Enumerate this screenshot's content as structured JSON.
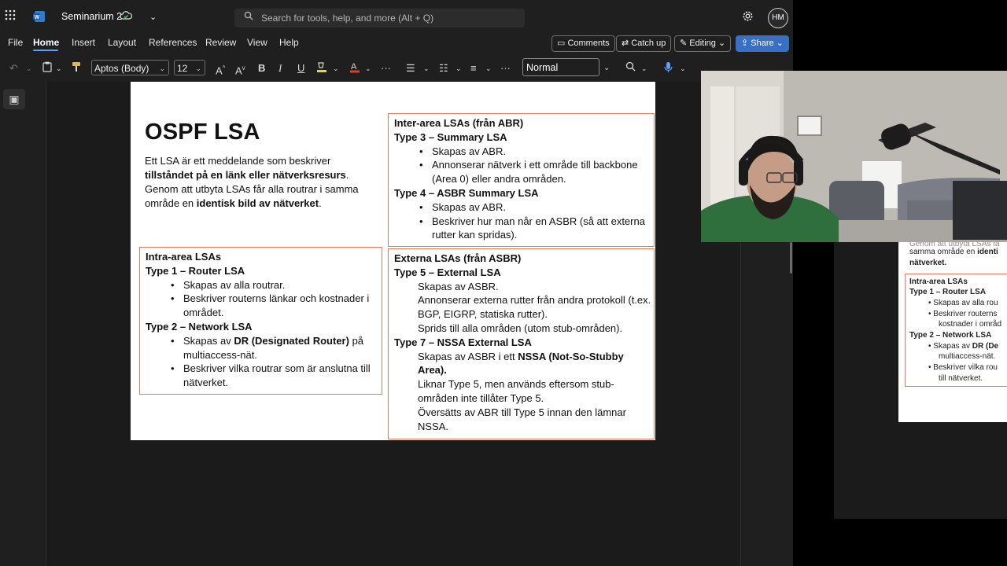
{
  "app": {
    "doc_title": "Seminarium 2",
    "search_placeholder": "Search for tools, help, and more (Alt + Q)",
    "avatar_initials": "HM",
    "icons": [
      "app-launcher-icon",
      "word-logo-icon",
      "cloud-sync-icon",
      "chevron-down-icon",
      "search-icon",
      "settings-icon"
    ]
  },
  "menu": {
    "items": [
      "File",
      "Home",
      "Insert",
      "Layout",
      "References",
      "Review",
      "View",
      "Help"
    ],
    "active": "Home",
    "comments": "Comments",
    "catchup": "Catch up",
    "editing": "Editing",
    "share": "Share"
  },
  "toolbar": {
    "font_name": "Aptos (Body)",
    "font_size": "12",
    "style": "Normal",
    "bold": "B",
    "italic": "I",
    "underline": "U"
  },
  "document": {
    "title": "OSPF LSA",
    "intro_1a": "Ett LSA är ett meddelande som beskriver ",
    "intro_1b": "tillståndet på en länk eller nätverksresurs",
    "intro_1c": ".",
    "intro_2a": "Genom att utbyta LSAs får alla routrar i samma område en ",
    "intro_2b": "identisk bild av nätverket",
    "intro_2c": ".",
    "intra": {
      "heading": "Intra-area LSAs",
      "t1": "Type 1 – Router LSA",
      "t1_b1": "Skapas av alla routrar.",
      "t1_b2": "Beskriver routerns länkar och kostnader i området.",
      "t2": "Type 2 – Network LSA",
      "t2_b1a": "Skapas av ",
      "t2_b1b": "DR (Designated Router)",
      "t2_b1c": " på multiaccess-nät.",
      "t2_b2": "Beskriver vilka routrar som är anslutna till nätverket."
    },
    "inter": {
      "heading": "Inter-area LSAs (från ABR)",
      "t3": "Type 3 – Summary LSA",
      "t3_b1": "Skapas av ABR.",
      "t3_b2": "Annonserar nätverk i ett område till backbone (Area 0) eller andra områden.",
      "t4": "Type 4 – ASBR Summary LSA",
      "t4_b1": "Skapas av ABR.",
      "t4_b2": "Beskriver hur man når en ASBR (så att externa rutter kan spridas)."
    },
    "ext": {
      "heading": "Externa LSAs (från ASBR)",
      "t5": "Type 5 – External LSA",
      "t5_l1": "Skapas av ASBR.",
      "t5_l2": "Annonserar externa rutter från andra protokoll (t.ex. BGP, EIGRP, statiska rutter).",
      "t5_l3": "Sprids till alla områden (utom stub-områden).",
      "t7": "Type 7 – NSSA External LSA",
      "t7_l1a": "Skapas av ASBR i ett ",
      "t7_l1b": "NSSA (Not-So-Stubby Area).",
      "t7_l2": "Liknar Type 5, men används eftersom stub-områden inte tillåter Type 5.",
      "t7_l3": "Översätts av ABR till Type 5 innan den lämnar NSSA."
    }
  },
  "second_window": {
    "line_a": "Genom att utbyta LSAs fa",
    "line_b1": "samma område en ",
    "line_b2": "identi",
    "line_c": "nätverket.",
    "heading": "Intra-area LSAs",
    "t1": "Type 1 – Router LSA",
    "b1": "Skapas av alla rou",
    "b2": "Beskriver routerns",
    "b2b": "kostnader i områd",
    "t2": "Type 2 – Network LSA",
    "b3a": "Skapas av ",
    "b3b": "DR (De",
    "b3c": "multiaccess-nät.",
    "b4": "Beskriver vilka rou",
    "b4b": "till nätverket."
  }
}
